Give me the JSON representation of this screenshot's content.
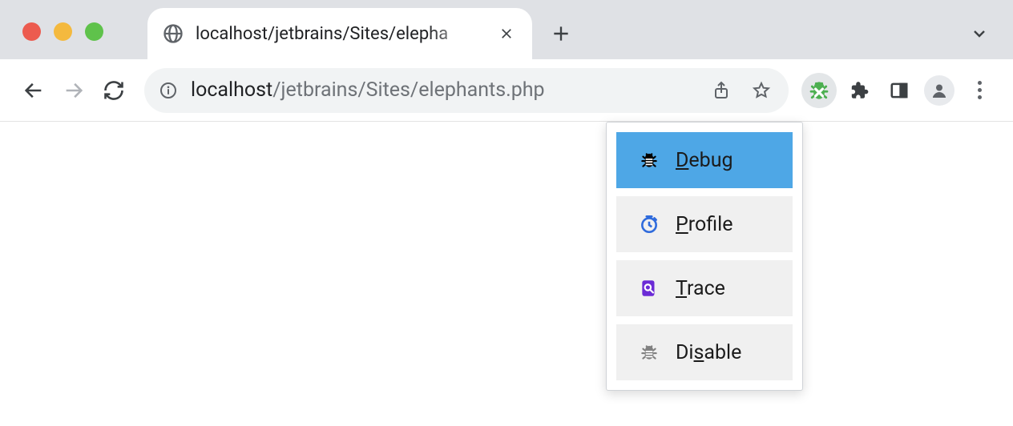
{
  "tab": {
    "title": "localhost/jetbrains/Sites/elepha"
  },
  "url": {
    "host": "localhost",
    "path": "/jetbrains/Sites/elephants.php"
  },
  "ext_popup": {
    "items": [
      {
        "label_pre": "",
        "label_ul": "D",
        "label_post": "ebug",
        "icon": "bug",
        "color": "#000000",
        "selected": true
      },
      {
        "label_pre": "",
        "label_ul": "P",
        "label_post": "rofile",
        "icon": "clock",
        "color": "#2f6bdc",
        "selected": false
      },
      {
        "label_pre": "",
        "label_ul": "T",
        "label_post": "race",
        "icon": "search",
        "color": "#6b2bd6",
        "selected": false
      },
      {
        "label_pre": "Di",
        "label_ul": "s",
        "label_post": "able",
        "icon": "bug",
        "color": "#808080",
        "selected": false
      }
    ]
  }
}
